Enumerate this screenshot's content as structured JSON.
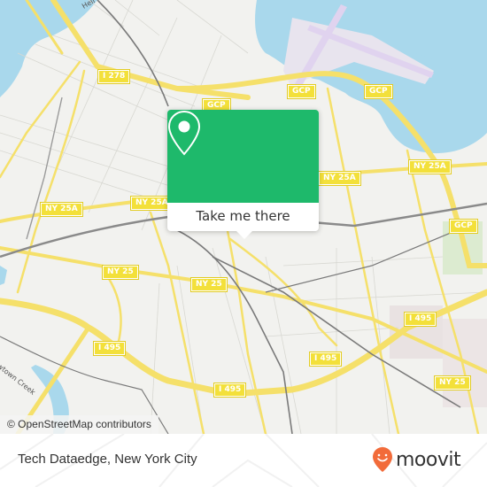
{
  "map": {
    "colors": {
      "land": "#f2f2ef",
      "water": "#a9d8ec",
      "major_road": "#f5e06a",
      "rail": "#7a7a7a",
      "airport": "#e5dcf0",
      "park": "#d7ebc6",
      "accent": "#1eb96b",
      "brand": "#f26b3a"
    },
    "shields": [
      {
        "id": "i278",
        "label": "I 278"
      },
      {
        "id": "gcp-1",
        "label": "GCP"
      },
      {
        "id": "gcp-2",
        "label": "GCP"
      },
      {
        "id": "gcp-3",
        "label": "GCP"
      },
      {
        "id": "gcp-4",
        "label": "GCP"
      },
      {
        "id": "ny25a-1",
        "label": "NY 25A"
      },
      {
        "id": "ny25a-2",
        "label": "NY 25A"
      },
      {
        "id": "ny25a-3",
        "label": "NY 25A"
      },
      {
        "id": "ny25a-4",
        "label": "NY 25A"
      },
      {
        "id": "ny25-1",
        "label": "NY 25"
      },
      {
        "id": "ny25-2",
        "label": "NY 25"
      },
      {
        "id": "ny25-3",
        "label": "NY 25"
      },
      {
        "id": "i495-1",
        "label": "I 495"
      },
      {
        "id": "i495-2",
        "label": "I 495"
      },
      {
        "id": "i495-3",
        "label": "I 495"
      },
      {
        "id": "i495-4",
        "label": "I 495"
      }
    ],
    "place_labels": {
      "creek": "Newtown Creek",
      "river": "Hell"
    },
    "attribution": "© OpenStreetMap contributors"
  },
  "popup": {
    "icon": "location-pin-icon",
    "button_label": "Take me there"
  },
  "footer": {
    "title": "Tech Dataedge, New York City",
    "brand_name": "moovit",
    "brand_icon": "moovit-smiley-pin-icon"
  }
}
